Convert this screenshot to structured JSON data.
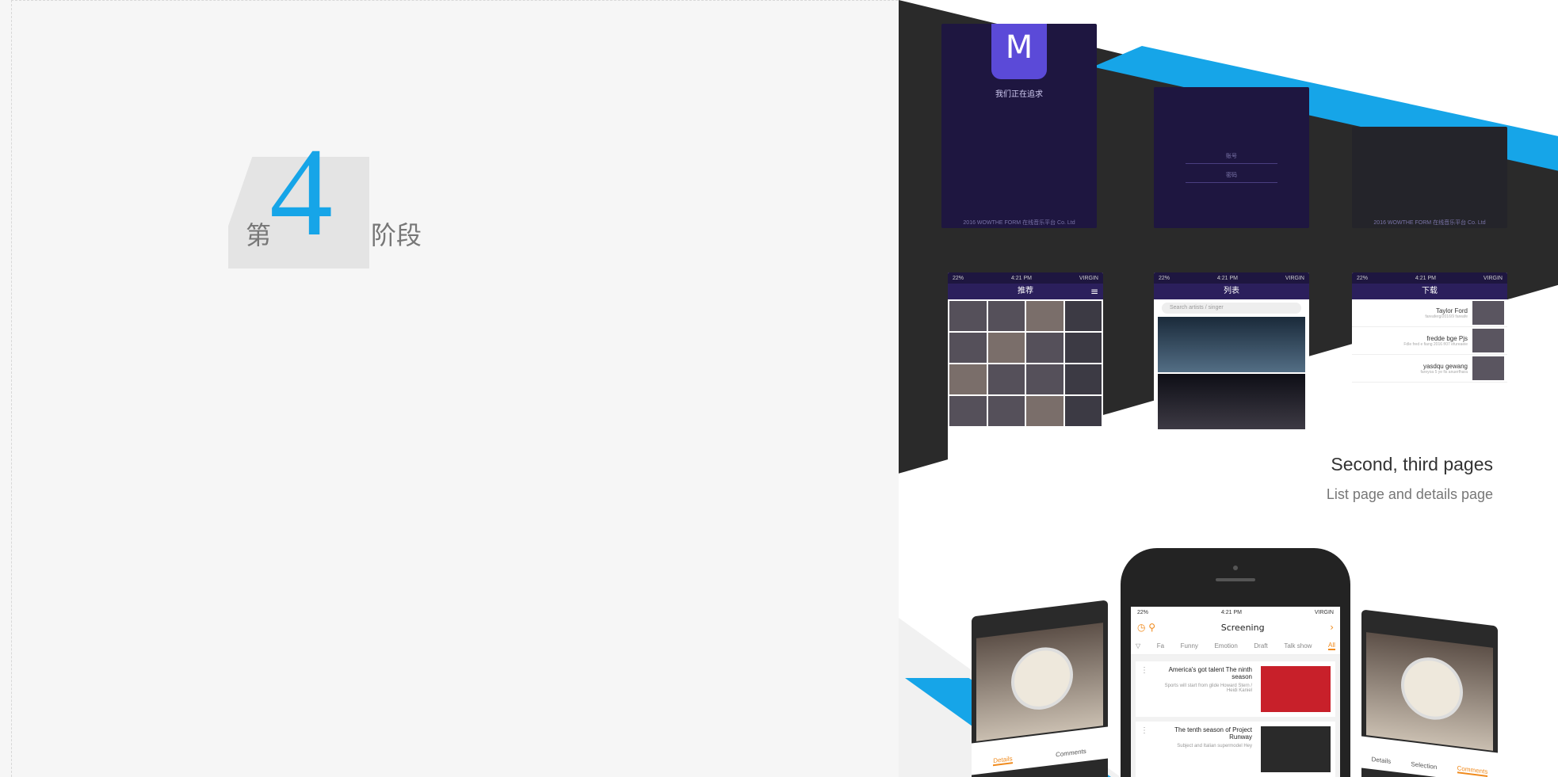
{
  "stage": {
    "prefix": "第",
    "number": "4",
    "suffix": "阶段"
  },
  "splash": {
    "app_name": "我们正在追求",
    "icon_glyph": "M",
    "footer": "2016 WOWTHE FORM 在线音乐平台 Co. Ltd"
  },
  "login": {
    "field_1": "账号",
    "field_2": "密码"
  },
  "screens": {
    "recommend": {
      "title": "推荐",
      "status_left": "22%",
      "status_time": "4:21 PM",
      "status_right": "VIRGIN"
    },
    "list": {
      "title": "列表",
      "search_placeholder": "Search artists / singer"
    },
    "download": {
      "title": "下载",
      "items": [
        {
          "name": "Taylor Ford",
          "sub": "fareaferg/2016/9 fareafe"
        },
        {
          "name": "fredde bge Pjs",
          "sub": "Fdle fred e fiang 2016 f/07 efureaeie"
        },
        {
          "name": "yasdqu gewang",
          "sub": "fareyoa 5 ye fis anuerfhara"
        }
      ]
    }
  },
  "caption": {
    "title": "Second, third pages",
    "subtitle": "List page and details page"
  },
  "phone": {
    "status_left": "22%",
    "status_time": "4:21 PM",
    "status_right": "VIRGIN",
    "title": "Screening",
    "tabs": [
      "Fa",
      "Funny",
      "Emotion",
      "Draft",
      "Talk show",
      "All"
    ],
    "items": [
      {
        "title": "America's got talent The ninth season",
        "desc": "Sports will start from glide Howard Stern / Heidi Kaniel"
      },
      {
        "title": "The tenth season of Project Runway",
        "desc": "Subject and Italian supermodel Hey"
      }
    ]
  },
  "side_left": {
    "tabs": [
      "Details",
      "Comments"
    ]
  },
  "side_right": {
    "tabs": [
      "Details",
      "Selection",
      "Comments"
    ]
  },
  "colors": {
    "accent_blue": "#16a5e8",
    "orange": "#f08a1c",
    "dark": "#2a2a2a"
  }
}
